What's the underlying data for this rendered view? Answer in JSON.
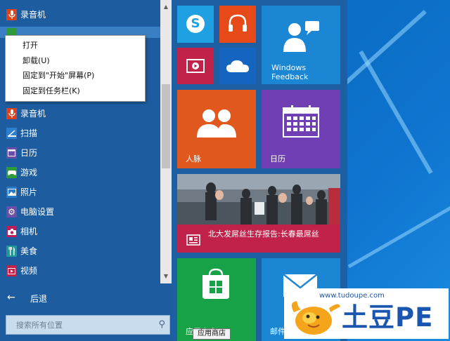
{
  "start_menu": {
    "app_list": [
      {
        "label": "录音机",
        "icon": "microphone-icon",
        "color": "#d9431e"
      },
      {
        "label": "",
        "icon": "controller-icon",
        "color": "#2f9a3a"
      },
      {
        "label": "录音机",
        "icon": "microphone-icon",
        "color": "#d9431e"
      },
      {
        "label": "扫描",
        "icon": "scanner-icon",
        "color": "#2f7fd0"
      },
      {
        "label": "日历",
        "icon": "calendar-icon",
        "color": "#6b4ea8"
      },
      {
        "label": "游戏",
        "icon": "controller-icon",
        "color": "#2f9a3a"
      },
      {
        "label": "照片",
        "icon": "photo-icon",
        "color": "#2a79c7"
      },
      {
        "label": "电脑设置",
        "icon": "gear-icon",
        "color": "#6b4ea8"
      },
      {
        "label": "相机",
        "icon": "camera-icon",
        "color": "#b91d5a"
      },
      {
        "label": "美食",
        "icon": "fork-knife-icon",
        "color": "#1f9a94"
      },
      {
        "label": "视频",
        "icon": "video-icon",
        "color": "#c1224a"
      }
    ],
    "back_label": "后退",
    "search_placeholder": "搜索所有位置",
    "context_menu": {
      "items": [
        "打开",
        "卸载(U)",
        "固定到\"开始\"屏幕(P)",
        "固定到任务栏(K)"
      ]
    },
    "tiles": {
      "skype": {
        "icon": "skype-icon",
        "color": "#1fa0e3"
      },
      "music": {
        "icon": "headphones-icon",
        "color": "#e64a19"
      },
      "feedback": {
        "label_line1": "Windows",
        "label_line2": "Feedback",
        "icon": "feedback-chat-icon",
        "color": "#1b86d4"
      },
      "video": {
        "icon": "video-player-icon",
        "color": "#c1224a"
      },
      "onedrive": {
        "icon": "cloud-icon",
        "color": "#1565c0"
      },
      "people": {
        "label": "人脉",
        "icon": "people-icon",
        "color": "#e0581d"
      },
      "calendar": {
        "label": "日历",
        "icon": "calendar-grid-icon",
        "color": "#6f3fb3"
      },
      "news": {
        "headline": "北大发屌丝生存报告:长春最屌丝",
        "icon": "news-icon",
        "color": "#c1224a"
      },
      "store": {
        "label": "应用商店",
        "icon": "store-icon",
        "color": "#17a247"
      },
      "mail": {
        "label": "邮件",
        "icon": "mail-icon",
        "color": "#1b86d4"
      }
    },
    "tooltip": "应用商店"
  },
  "watermark": {
    "url": "www.tudoupe.com",
    "brand": "土豆PE"
  }
}
